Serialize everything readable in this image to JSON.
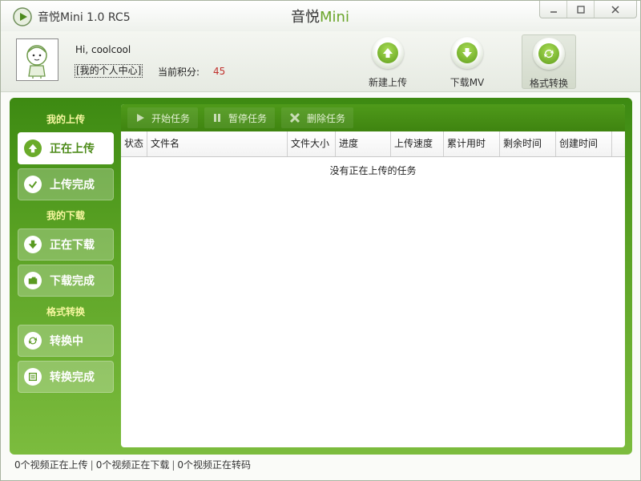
{
  "window": {
    "app_title": "音悦Mini 1.0 RC5",
    "center_title_a": "音悦",
    "center_title_b": "Mini",
    "buttons": [
      "minimize",
      "maximize",
      "close"
    ]
  },
  "user": {
    "greeting": "Hi, coolcool",
    "center_link": "[我的个人中心]",
    "points_label": "当前积分:",
    "points_value": "45"
  },
  "tools": [
    {
      "label": "新建上传",
      "icon": "upload-arrow-icon"
    },
    {
      "label": "下载MV",
      "icon": "download-arrow-icon"
    },
    {
      "label": "格式转换",
      "icon": "convert-icon",
      "active": true
    }
  ],
  "sidebar": {
    "upload_heading": "我的上传",
    "download_heading": "我的下载",
    "convert_heading": "格式转换",
    "items": [
      {
        "label": "正在上传",
        "active": true
      },
      {
        "label": "上传完成"
      },
      {
        "label": "正在下载"
      },
      {
        "label": "下载完成"
      },
      {
        "label": "转换中"
      },
      {
        "label": "转换完成"
      }
    ]
  },
  "toolbar": {
    "start": "开始任务",
    "pause": "暂停任务",
    "delete": "删除任务"
  },
  "table": {
    "columns": [
      "状态",
      "文件名",
      "文件大小",
      "进度",
      "上传速度",
      "累计用时",
      "剩余时间",
      "创建时间"
    ],
    "empty_message": "没有正在上传的任务"
  },
  "status": {
    "uploading": "0个视频正在上传",
    "downloading": "0个视频正在下载",
    "converting": "0个视频正在转码"
  },
  "colors": {
    "accent_green": "#5aa224",
    "points_red": "#c0302c"
  }
}
